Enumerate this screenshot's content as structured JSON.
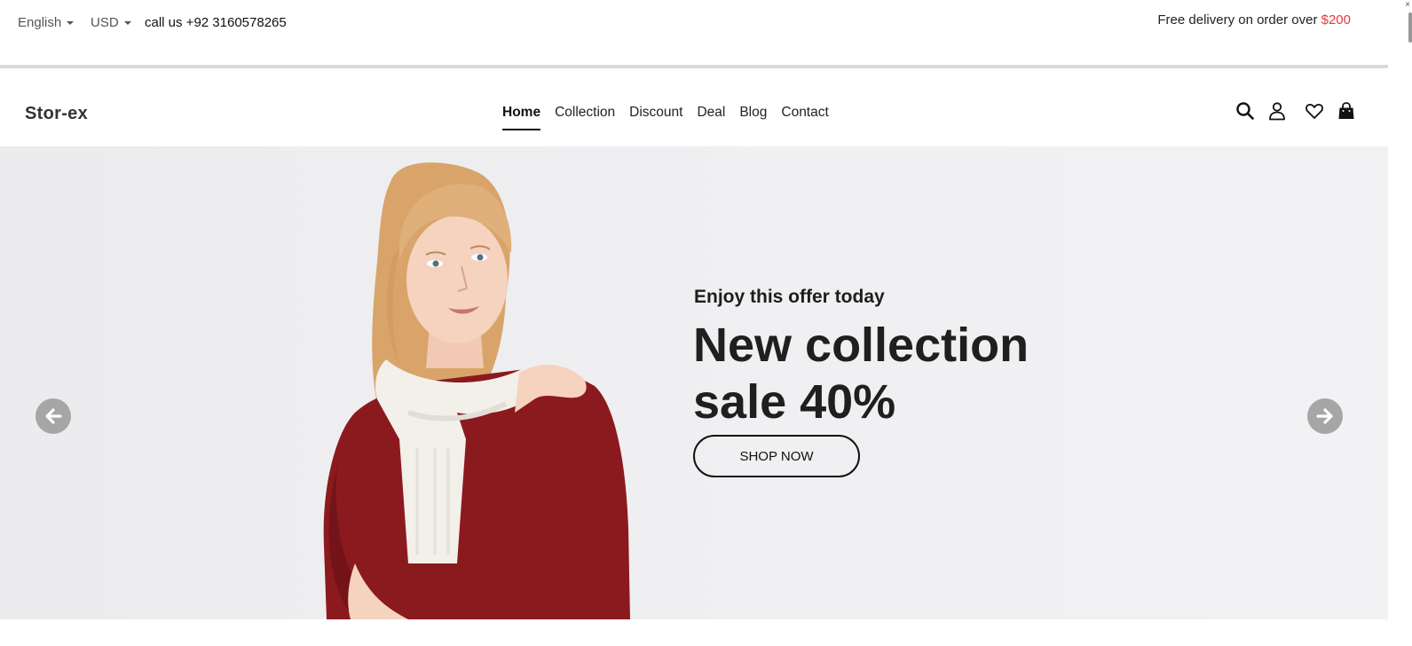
{
  "topbar": {
    "language": "English",
    "currency": "USD",
    "phone": "call us +92 3160578265",
    "promo_text": "Free delivery on order over ",
    "promo_amount": "$200"
  },
  "nav": {
    "logo": "Stor-ex",
    "links": [
      {
        "label": "Home",
        "active": true
      },
      {
        "label": "Collection",
        "active": false
      },
      {
        "label": "Discount",
        "active": false
      },
      {
        "label": "Deal",
        "active": false
      },
      {
        "label": "Blog",
        "active": false
      },
      {
        "label": "Contact",
        "active": false
      }
    ],
    "icons": [
      "search-icon",
      "user-icon",
      "heart-icon",
      "shopping-bag-icon"
    ]
  },
  "hero": {
    "subtitle": "Enjoy this offer today",
    "title_line1": "New collection",
    "title_line2": "sale 40%",
    "cta_label": "SHOP NOW"
  },
  "colors": {
    "accent_red": "#e53935",
    "text_dark": "#1f1f1f",
    "arrow_gray": "#a6a6a6",
    "dress": "#8b1a1f"
  }
}
